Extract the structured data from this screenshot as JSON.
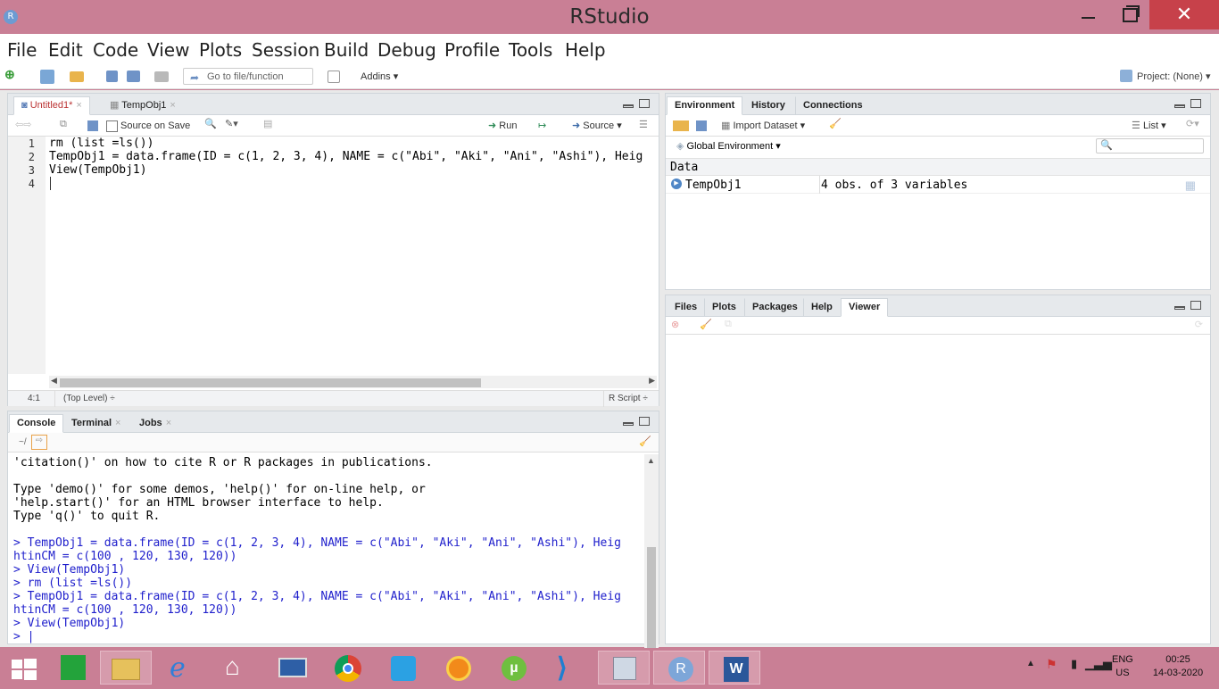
{
  "window": {
    "title": "RStudio",
    "app_icon": "R",
    "close_glyph": "✕"
  },
  "menu": [
    "File",
    "Edit",
    "Code",
    "View",
    "Plots",
    "Session",
    "Build",
    "Debug",
    "Profile",
    "Tools",
    "Help"
  ],
  "toolbar": {
    "goto_placeholder": "Go to file/function",
    "addins": "Addins",
    "project": "Project: (None)"
  },
  "source": {
    "tabs": [
      {
        "label": "Untitled1*"
      },
      {
        "label": "TempObj1"
      }
    ],
    "source_on_save": "Source on Save",
    "run": "Run",
    "source": "Source",
    "line_numbers": [
      "1",
      "2",
      "3",
      "4"
    ],
    "lines": [
      "rm (list =ls())",
      "TempObj1 = data.frame(ID = c(1, 2, 3, 4), NAME = c(\"Abi\", \"Aki\", \"Ani\", \"Ashi\"), Heig",
      "View(TempObj1)",
      ""
    ],
    "status": {
      "position": "4:1",
      "scope": "(Top Level) ÷",
      "filetype": "R Script ÷"
    }
  },
  "console": {
    "tabs": [
      {
        "label": "Console"
      },
      {
        "label": "Terminal"
      },
      {
        "label": "Jobs"
      }
    ],
    "path": "~/",
    "lines": [
      {
        "text": "'citation()' on how to cite R or R packages in publications.",
        "kind": "out"
      },
      {
        "text": "",
        "kind": "out"
      },
      {
        "text": "Type 'demo()' for some demos, 'help()' for on-line help, or",
        "kind": "out"
      },
      {
        "text": "'help.start()' for an HTML browser interface to help.",
        "kind": "out"
      },
      {
        "text": "Type 'q()' to quit R.",
        "kind": "out"
      },
      {
        "text": "",
        "kind": "out"
      },
      {
        "text": "> TempObj1 = data.frame(ID = c(1, 2, 3, 4), NAME = c(\"Abi\", \"Aki\", \"Ani\", \"Ashi\"), Heig",
        "kind": "in"
      },
      {
        "text": "htinCM = c(100 , 120, 130, 120))",
        "kind": "in"
      },
      {
        "text": "> View(TempObj1)",
        "kind": "in"
      },
      {
        "text": "> rm (list =ls())",
        "kind": "in"
      },
      {
        "text": "> TempObj1 = data.frame(ID = c(1, 2, 3, 4), NAME = c(\"Abi\", \"Aki\", \"Ani\", \"Ashi\"), Heig",
        "kind": "in"
      },
      {
        "text": "htinCM = c(100 , 120, 130, 120))",
        "kind": "in"
      },
      {
        "text": "> View(TempObj1)",
        "kind": "in"
      },
      {
        "text": "> |",
        "kind": "in"
      }
    ]
  },
  "environment": {
    "tabs": [
      {
        "label": "Environment"
      },
      {
        "label": "History"
      },
      {
        "label": "Connections"
      }
    ],
    "import": "Import Dataset",
    "list": "List",
    "scope": "Global Environment",
    "section": "Data",
    "rows": [
      {
        "name": "TempObj1",
        "value": "4 obs. of 3 variables"
      }
    ]
  },
  "files": {
    "tabs": [
      {
        "label": "Files"
      },
      {
        "label": "Plots"
      },
      {
        "label": "Packages"
      },
      {
        "label": "Help"
      },
      {
        "label": "Viewer"
      }
    ]
  },
  "taskbar": {
    "apps": [
      "start",
      "store",
      "explorer",
      "ie",
      "home",
      "lenovo",
      "chrome",
      "outlook",
      "player",
      "utorrent",
      "vscode",
      "notes",
      "rstudio",
      "word"
    ],
    "lang_top": "ENG",
    "lang_bottom": "US",
    "time": "00:25",
    "date": "14-03-2020"
  },
  "colors": {
    "title_bar": "#c97f95",
    "close": "#c7414a",
    "console_input": "#1f1fcc"
  }
}
